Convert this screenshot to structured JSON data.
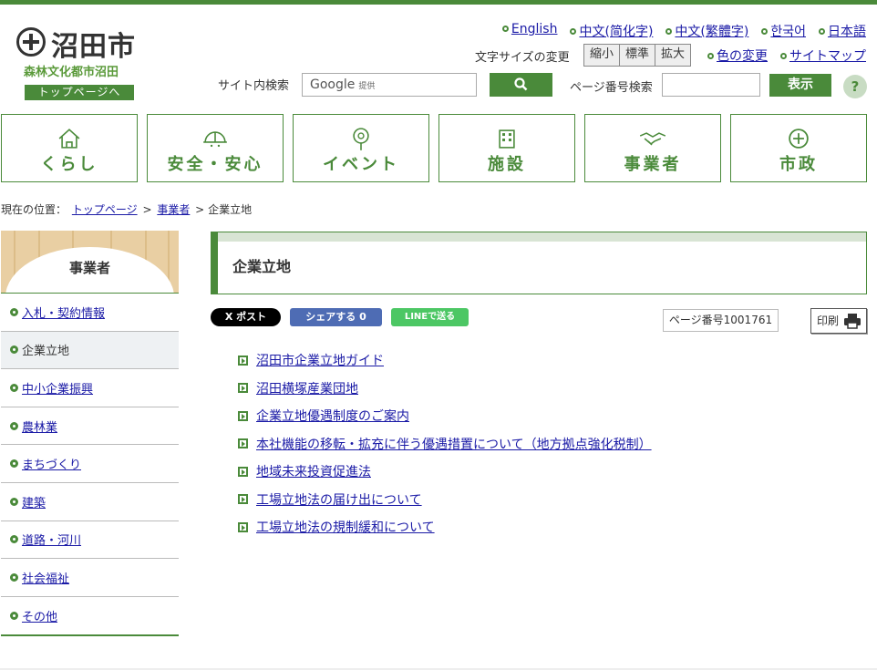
{
  "header": {
    "city_name": "沼田市",
    "subtitle": "森林文化都市沼田",
    "top_page_button": "トップページへ",
    "languages": [
      "English",
      "中文(简化字)",
      "中文(繁體字)",
      "한국어",
      "日本語"
    ],
    "font_size_label": "文字サイズの変更",
    "font_size_buttons": [
      "縮小",
      "標準",
      "拡大"
    ],
    "util_links": [
      "色の変更",
      "サイトマップ"
    ],
    "search_label": "サイト内検索",
    "search_placeholder": "Google",
    "search_provider": "提供",
    "page_number_label": "ページ番号検索",
    "show_button": "表示",
    "help_button": "?"
  },
  "gnav": [
    {
      "label": "くらし",
      "icon": "house-icon"
    },
    {
      "label": "安全・安心",
      "icon": "helmet-icon"
    },
    {
      "label": "イベント",
      "icon": "balloon-icon"
    },
    {
      "label": "施設",
      "icon": "building-icon"
    },
    {
      "label": "事業者",
      "icon": "handshake-icon"
    },
    {
      "label": "市政",
      "icon": "city-emblem-icon"
    }
  ],
  "breadcrumb": {
    "prefix": "現在の位置：",
    "items": [
      "トップページ",
      "事業者"
    ],
    "current": "企業立地",
    "separator": ">"
  },
  "sidebar": {
    "title": "事業者",
    "items": [
      {
        "label": "入札・契約情報",
        "current": false
      },
      {
        "label": "企業立地",
        "current": true
      },
      {
        "label": "中小企業振興",
        "current": false
      },
      {
        "label": "農林業",
        "current": false
      },
      {
        "label": "まちづくり",
        "current": false
      },
      {
        "label": "建築",
        "current": false
      },
      {
        "label": "道路・河川",
        "current": false
      },
      {
        "label": "社会福祉",
        "current": false
      },
      {
        "label": "その他",
        "current": false
      }
    ]
  },
  "main": {
    "title": "企業立地",
    "sns": {
      "x": "X ポスト",
      "facebook": "シェアする 0",
      "line": "LINEで送る"
    },
    "page_id": "ページ番号1001761",
    "print": "印刷",
    "links": [
      "沼田市企業立地ガイド",
      "沼田横塚産業団地",
      "企業立地優遇制度のご案内",
      "本社機能の移転・拡充に伴う優遇措置について（地方拠点強化税制）",
      "地域未来投資促進法",
      "工場立地法の届け出について",
      "工場立地法の規制緩和について"
    ]
  },
  "colors": {
    "accent": "#4a8a3a",
    "link": "#1a1aa6"
  }
}
